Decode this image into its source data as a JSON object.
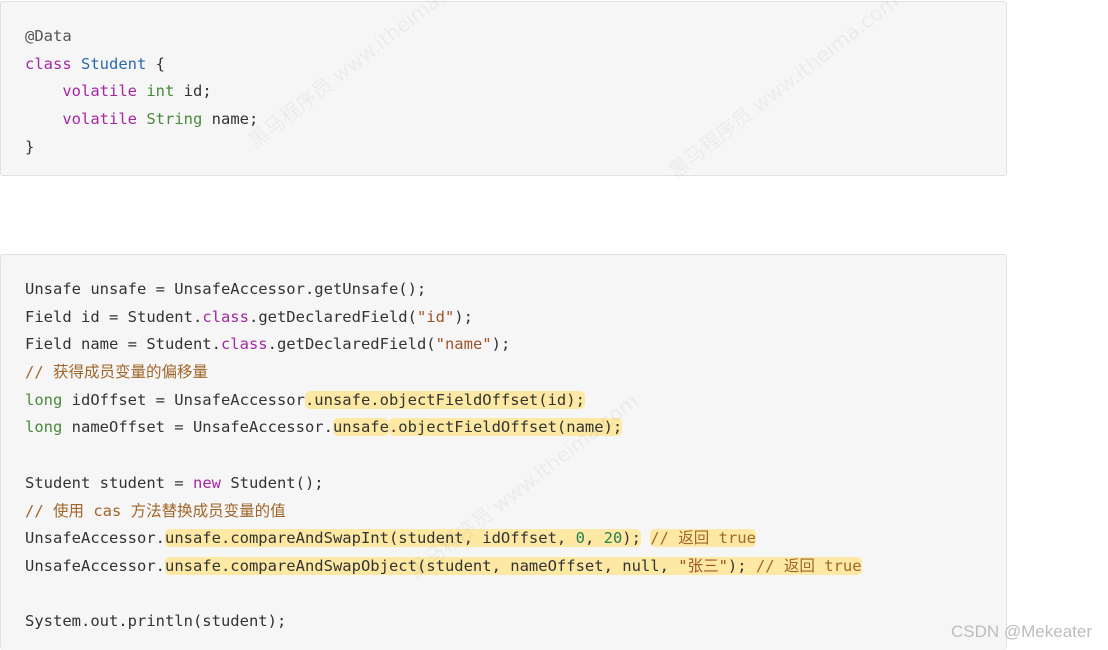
{
  "block1": {
    "annotation": "@Data",
    "class_keyword": "class",
    "class_name": "Student",
    "open_brace": " {",
    "field1": {
      "modifier": "volatile",
      "type": "int",
      "rest": " id;"
    },
    "field2": {
      "modifier": "volatile",
      "type": "String",
      "rest": " name;"
    },
    "close_brace": "}"
  },
  "block2": {
    "l1": "Unsafe unsafe = UnsafeAccessor.getUnsafe();",
    "l2": {
      "a": "Field id = Student.",
      "kw": "class",
      "b": ".getDeclaredField(",
      "str": "\"id\"",
      "c": ");"
    },
    "l3": {
      "a": "Field name = Student.",
      "kw": "class",
      "b": ".getDeclaredField(",
      "str": "\"name\"",
      "c": ");"
    },
    "l4_comment": "// 获得成员变量的偏移量",
    "l5": {
      "type": "long",
      "a": " idOffset = UnsafeAccessor",
      "hl": ".unsafe.objectFieldOffset(id);"
    },
    "l6": {
      "type": "long",
      "a": " nameOffset = UnsafeAccessor.",
      "hl1": "unsafe",
      "hl2": ".objectFieldOffset(name);"
    },
    "l8": {
      "a": "Student student = ",
      "kw": "new",
      "b": " Student();"
    },
    "l9_comment": "// 使用 cas 方法替换成员变量的值",
    "l10": {
      "a": "UnsafeAccessor.",
      "hl": "unsafe.compareAndSwapInt(student, idOffset, ",
      "n1": "0",
      "sep": ", ",
      "n2": "20",
      "end": ");",
      "comment": "// 返回 true"
    },
    "l11": {
      "a": "UnsafeAccessor.",
      "hl": "unsafe.compareAndSwapObject(student, nameOffset, null, ",
      "str": "\"张三\"",
      "end": ");",
      "comment": " // 返回 true"
    },
    "l13": "System.out.println(student);"
  },
  "watermark_text": "黑马程序员 www.itheima.com",
  "credit": "CSDN @Mekeater"
}
